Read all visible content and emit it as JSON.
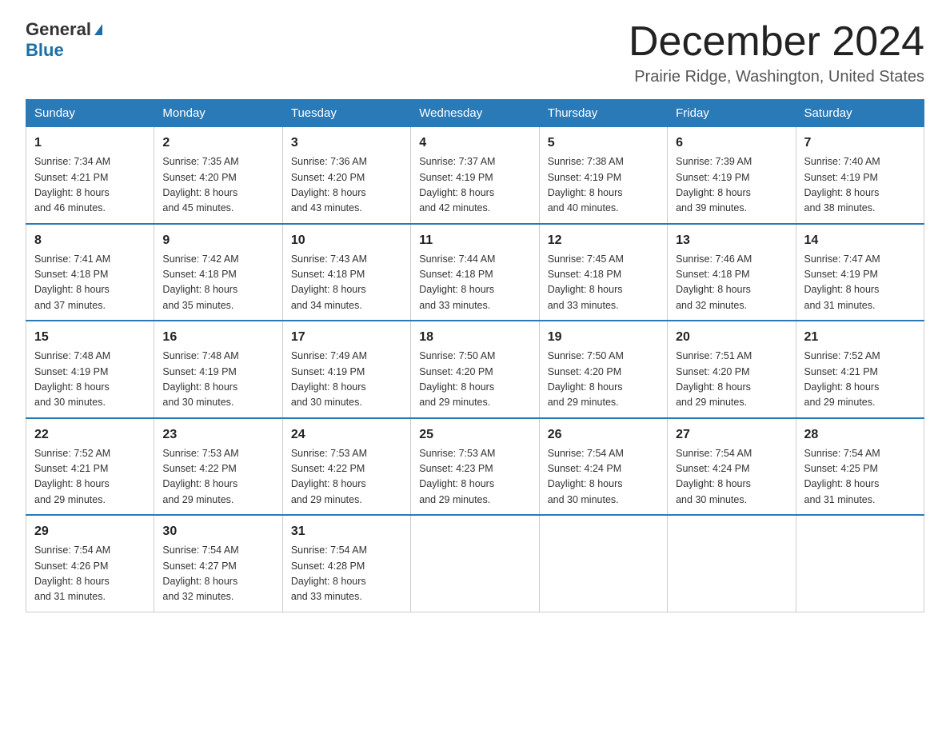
{
  "header": {
    "logo_general": "General",
    "logo_blue": "Blue",
    "month_title": "December 2024",
    "location": "Prairie Ridge, Washington, United States"
  },
  "weekdays": [
    "Sunday",
    "Monday",
    "Tuesday",
    "Wednesday",
    "Thursday",
    "Friday",
    "Saturday"
  ],
  "weeks": [
    [
      {
        "day": "1",
        "sunrise": "7:34 AM",
        "sunset": "4:21 PM",
        "daylight": "8 hours and 46 minutes."
      },
      {
        "day": "2",
        "sunrise": "7:35 AM",
        "sunset": "4:20 PM",
        "daylight": "8 hours and 45 minutes."
      },
      {
        "day": "3",
        "sunrise": "7:36 AM",
        "sunset": "4:20 PM",
        "daylight": "8 hours and 43 minutes."
      },
      {
        "day": "4",
        "sunrise": "7:37 AM",
        "sunset": "4:19 PM",
        "daylight": "8 hours and 42 minutes."
      },
      {
        "day": "5",
        "sunrise": "7:38 AM",
        "sunset": "4:19 PM",
        "daylight": "8 hours and 40 minutes."
      },
      {
        "day": "6",
        "sunrise": "7:39 AM",
        "sunset": "4:19 PM",
        "daylight": "8 hours and 39 minutes."
      },
      {
        "day": "7",
        "sunrise": "7:40 AM",
        "sunset": "4:19 PM",
        "daylight": "8 hours and 38 minutes."
      }
    ],
    [
      {
        "day": "8",
        "sunrise": "7:41 AM",
        "sunset": "4:18 PM",
        "daylight": "8 hours and 37 minutes."
      },
      {
        "day": "9",
        "sunrise": "7:42 AM",
        "sunset": "4:18 PM",
        "daylight": "8 hours and 35 minutes."
      },
      {
        "day": "10",
        "sunrise": "7:43 AM",
        "sunset": "4:18 PM",
        "daylight": "8 hours and 34 minutes."
      },
      {
        "day": "11",
        "sunrise": "7:44 AM",
        "sunset": "4:18 PM",
        "daylight": "8 hours and 33 minutes."
      },
      {
        "day": "12",
        "sunrise": "7:45 AM",
        "sunset": "4:18 PM",
        "daylight": "8 hours and 33 minutes."
      },
      {
        "day": "13",
        "sunrise": "7:46 AM",
        "sunset": "4:18 PM",
        "daylight": "8 hours and 32 minutes."
      },
      {
        "day": "14",
        "sunrise": "7:47 AM",
        "sunset": "4:19 PM",
        "daylight": "8 hours and 31 minutes."
      }
    ],
    [
      {
        "day": "15",
        "sunrise": "7:48 AM",
        "sunset": "4:19 PM",
        "daylight": "8 hours and 30 minutes."
      },
      {
        "day": "16",
        "sunrise": "7:48 AM",
        "sunset": "4:19 PM",
        "daylight": "8 hours and 30 minutes."
      },
      {
        "day": "17",
        "sunrise": "7:49 AM",
        "sunset": "4:19 PM",
        "daylight": "8 hours and 30 minutes."
      },
      {
        "day": "18",
        "sunrise": "7:50 AM",
        "sunset": "4:20 PM",
        "daylight": "8 hours and 29 minutes."
      },
      {
        "day": "19",
        "sunrise": "7:50 AM",
        "sunset": "4:20 PM",
        "daylight": "8 hours and 29 minutes."
      },
      {
        "day": "20",
        "sunrise": "7:51 AM",
        "sunset": "4:20 PM",
        "daylight": "8 hours and 29 minutes."
      },
      {
        "day": "21",
        "sunrise": "7:52 AM",
        "sunset": "4:21 PM",
        "daylight": "8 hours and 29 minutes."
      }
    ],
    [
      {
        "day": "22",
        "sunrise": "7:52 AM",
        "sunset": "4:21 PM",
        "daylight": "8 hours and 29 minutes."
      },
      {
        "day": "23",
        "sunrise": "7:53 AM",
        "sunset": "4:22 PM",
        "daylight": "8 hours and 29 minutes."
      },
      {
        "day": "24",
        "sunrise": "7:53 AM",
        "sunset": "4:22 PM",
        "daylight": "8 hours and 29 minutes."
      },
      {
        "day": "25",
        "sunrise": "7:53 AM",
        "sunset": "4:23 PM",
        "daylight": "8 hours and 29 minutes."
      },
      {
        "day": "26",
        "sunrise": "7:54 AM",
        "sunset": "4:24 PM",
        "daylight": "8 hours and 30 minutes."
      },
      {
        "day": "27",
        "sunrise": "7:54 AM",
        "sunset": "4:24 PM",
        "daylight": "8 hours and 30 minutes."
      },
      {
        "day": "28",
        "sunrise": "7:54 AM",
        "sunset": "4:25 PM",
        "daylight": "8 hours and 31 minutes."
      }
    ],
    [
      {
        "day": "29",
        "sunrise": "7:54 AM",
        "sunset": "4:26 PM",
        "daylight": "8 hours and 31 minutes."
      },
      {
        "day": "30",
        "sunrise": "7:54 AM",
        "sunset": "4:27 PM",
        "daylight": "8 hours and 32 minutes."
      },
      {
        "day": "31",
        "sunrise": "7:54 AM",
        "sunset": "4:28 PM",
        "daylight": "8 hours and 33 minutes."
      },
      null,
      null,
      null,
      null
    ]
  ],
  "labels": {
    "sunrise": "Sunrise:",
    "sunset": "Sunset:",
    "daylight": "Daylight:"
  }
}
